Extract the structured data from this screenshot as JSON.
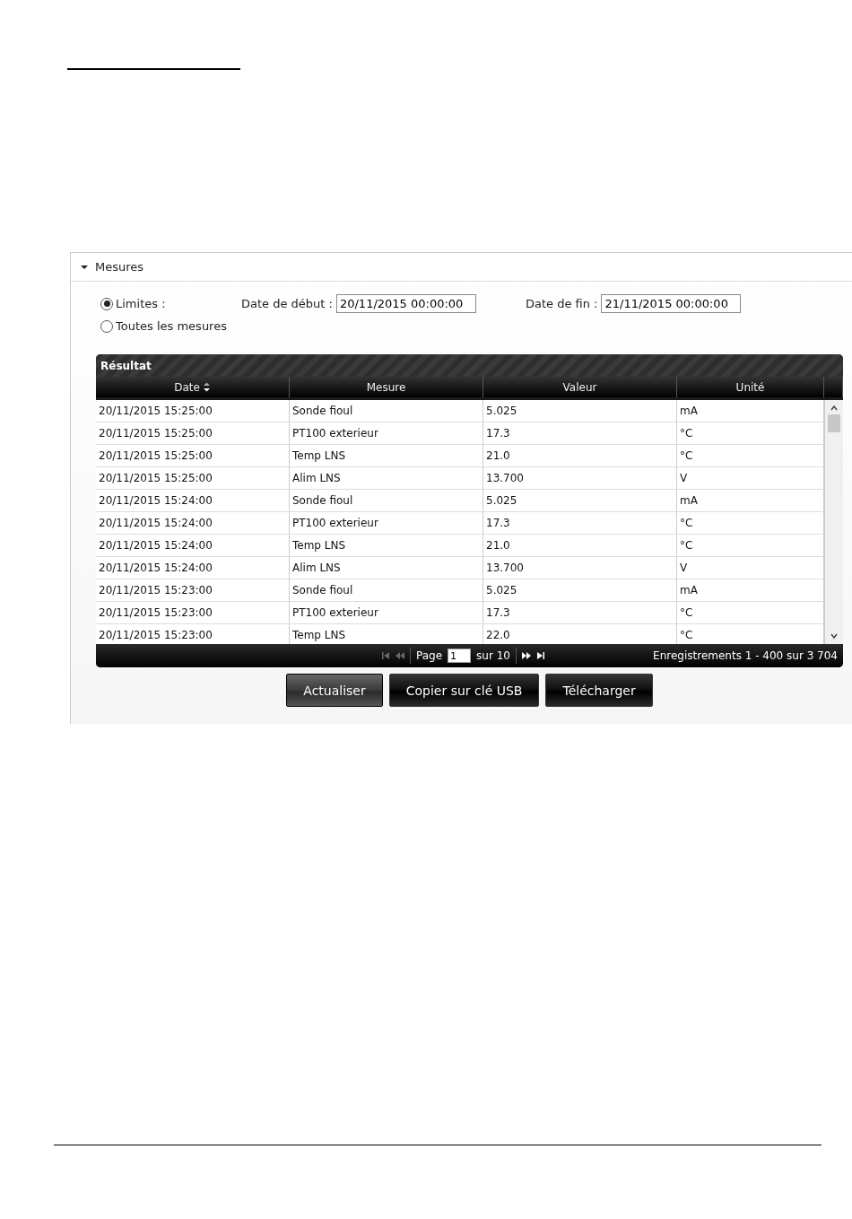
{
  "panel": {
    "title": "Mesures",
    "expanded": true,
    "filter": {
      "options": [
        {
          "label": "Limites :",
          "selected": true
        },
        {
          "label": "Toutes les mesures",
          "selected": false
        }
      ],
      "start": {
        "label": "Date de début :",
        "value": "20/11/2015 00:00:00"
      },
      "end": {
        "label": "Date de fin :",
        "value": "21/11/2015 00:00:00"
      }
    },
    "grid": {
      "title": "Résultat",
      "columns": [
        {
          "label": "Date",
          "sorted": true
        },
        {
          "label": "Mesure",
          "sorted": false
        },
        {
          "label": "Valeur",
          "sorted": false
        },
        {
          "label": "Unité",
          "sorted": false
        }
      ],
      "rows": [
        [
          "20/11/2015 15:25:00",
          "Sonde fioul",
          "5.025",
          "mA"
        ],
        [
          "20/11/2015 15:25:00",
          "PT100 exterieur",
          "17.3",
          "°C"
        ],
        [
          "20/11/2015 15:25:00",
          "Temp LNS",
          "21.0",
          "°C"
        ],
        [
          "20/11/2015 15:25:00",
          "Alim LNS",
          "13.700",
          "V"
        ],
        [
          "20/11/2015 15:24:00",
          "Sonde fioul",
          "5.025",
          "mA"
        ],
        [
          "20/11/2015 15:24:00",
          "PT100 exterieur",
          "17.3",
          "°C"
        ],
        [
          "20/11/2015 15:24:00",
          "Temp LNS",
          "21.0",
          "°C"
        ],
        [
          "20/11/2015 15:24:00",
          "Alim LNS",
          "13.700",
          "V"
        ],
        [
          "20/11/2015 15:23:00",
          "Sonde fioul",
          "5.025",
          "mA"
        ],
        [
          "20/11/2015 15:23:00",
          "PT100 exterieur",
          "17.3",
          "°C"
        ],
        [
          "20/11/2015 15:23:00",
          "Temp LNS",
          "22.0",
          "°C"
        ]
      ],
      "pager": {
        "page_label": "Page",
        "page_value": "1",
        "total": "sur 10",
        "records": "Enregistrements 1 - 400 sur 3 704"
      }
    },
    "buttons": [
      {
        "label": "Actualiser",
        "selected": true
      },
      {
        "label": "Copier sur clé USB",
        "selected": false
      },
      {
        "label": "Télécharger",
        "selected": false
      }
    ]
  }
}
